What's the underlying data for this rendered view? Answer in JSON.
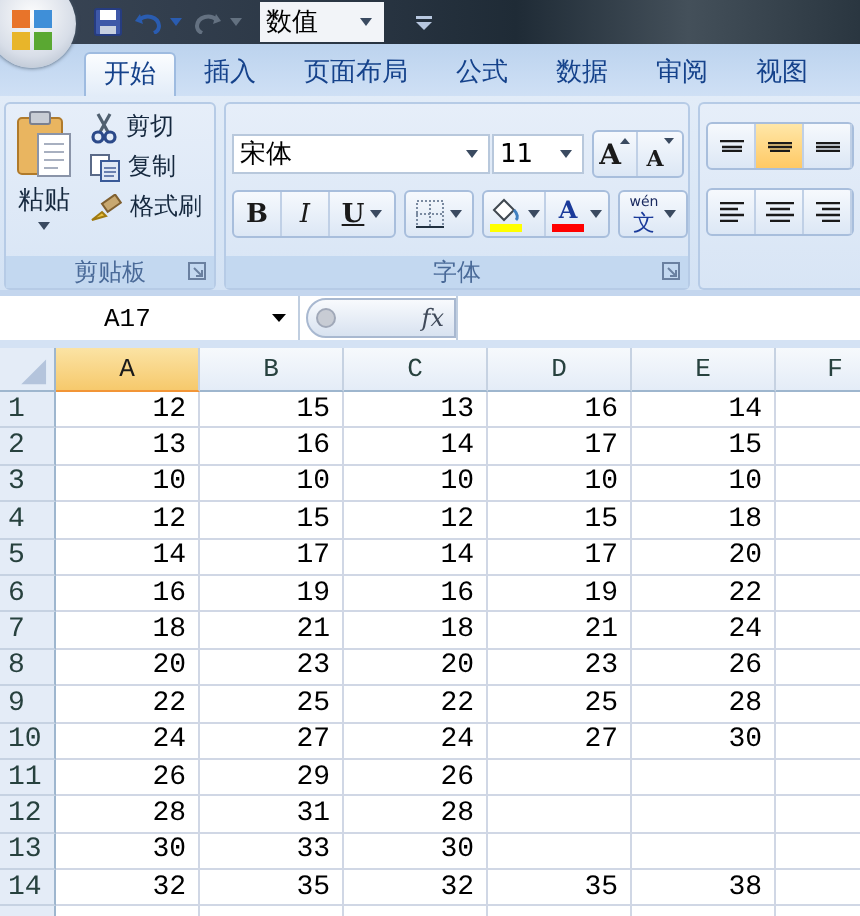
{
  "quick_access": [
    {
      "kind": "save",
      "disabled": false
    },
    {
      "kind": "undo",
      "disabled": false
    },
    {
      "kind": "redo",
      "disabled": true
    }
  ],
  "number_format_box": "数值",
  "tabs": [
    {
      "label": "开始",
      "selected": true
    },
    {
      "label": "插入",
      "selected": false
    },
    {
      "label": "页面布局",
      "selected": false
    },
    {
      "label": "公式",
      "selected": false
    },
    {
      "label": "数据",
      "selected": false
    },
    {
      "label": "审阅",
      "selected": false
    },
    {
      "label": "视图",
      "selected": false
    }
  ],
  "clipboard": {
    "paste": "粘贴",
    "actions": [
      {
        "kind": "cut",
        "label": "剪切"
      },
      {
        "kind": "copy",
        "label": "复制"
      },
      {
        "kind": "format_painter",
        "label": "格式刷"
      }
    ],
    "group_label": "剪贴板"
  },
  "font": {
    "font_name": "宋体",
    "font_size": "11",
    "size_buttons": [
      {
        "kind": "grow",
        "label": "A"
      },
      {
        "kind": "shrink",
        "label": "A"
      }
    ],
    "style_buttons": [
      {
        "kind": "bold",
        "label": "B"
      },
      {
        "kind": "italic",
        "label": "I"
      },
      {
        "kind": "underline",
        "label": "U"
      }
    ],
    "color_buttons": [
      {
        "kind": "fill",
        "color": "#ffff00"
      },
      {
        "kind": "font_color",
        "label": "A",
        "color": "#ff0000"
      }
    ],
    "phonetic": {
      "label": "wén",
      "glyph": "文"
    },
    "group_label": "字体"
  },
  "alignment": {
    "vertical": [
      {
        "kind": "top",
        "selected": false
      },
      {
        "kind": "middle",
        "selected": true
      },
      {
        "kind": "bottom",
        "selected": false
      }
    ],
    "horizontal": [
      {
        "kind": "left",
        "selected": false
      },
      {
        "kind": "center",
        "selected": false
      },
      {
        "kind": "right",
        "selected": false
      }
    ]
  },
  "formula_bar": {
    "name_box": "A17",
    "function_label": "fx"
  },
  "sheet": {
    "columns": [
      {
        "label": "A",
        "selected": true
      },
      {
        "label": "B",
        "selected": false
      },
      {
        "label": "C",
        "selected": false
      },
      {
        "label": "D",
        "selected": false
      },
      {
        "label": "E",
        "selected": false
      },
      {
        "label": "F",
        "selected": false
      }
    ],
    "rows": [
      {
        "label": "1",
        "cells": [
          "12",
          "15",
          "13",
          "16",
          "14"
        ]
      },
      {
        "label": "2",
        "cells": [
          "13",
          "16",
          "14",
          "17",
          "15"
        ]
      },
      {
        "label": "3",
        "cells": [
          "10",
          "10",
          "10",
          "10",
          "10"
        ]
      },
      {
        "label": "4",
        "cells": [
          "12",
          "15",
          "12",
          "15",
          "18"
        ]
      },
      {
        "label": "5",
        "cells": [
          "14",
          "17",
          "14",
          "17",
          "20"
        ]
      },
      {
        "label": "6",
        "cells": [
          "16",
          "19",
          "16",
          "19",
          "22"
        ]
      },
      {
        "label": "7",
        "cells": [
          "18",
          "21",
          "18",
          "21",
          "24"
        ]
      },
      {
        "label": "8",
        "cells": [
          "20",
          "23",
          "20",
          "23",
          "26"
        ]
      },
      {
        "label": "9",
        "cells": [
          "22",
          "25",
          "22",
          "25",
          "28"
        ]
      },
      {
        "label": "10",
        "cells": [
          "24",
          "27",
          "24",
          "27",
          "30"
        ]
      },
      {
        "label": "11",
        "cells": [
          "26",
          "29",
          "26"
        ]
      },
      {
        "label": "12",
        "cells": [
          "28",
          "31",
          "28"
        ]
      },
      {
        "label": "13",
        "cells": [
          "30",
          "33",
          "30"
        ]
      },
      {
        "label": "14",
        "cells": [
          "32",
          "35",
          "32",
          "35",
          "38"
        ]
      }
    ]
  }
}
